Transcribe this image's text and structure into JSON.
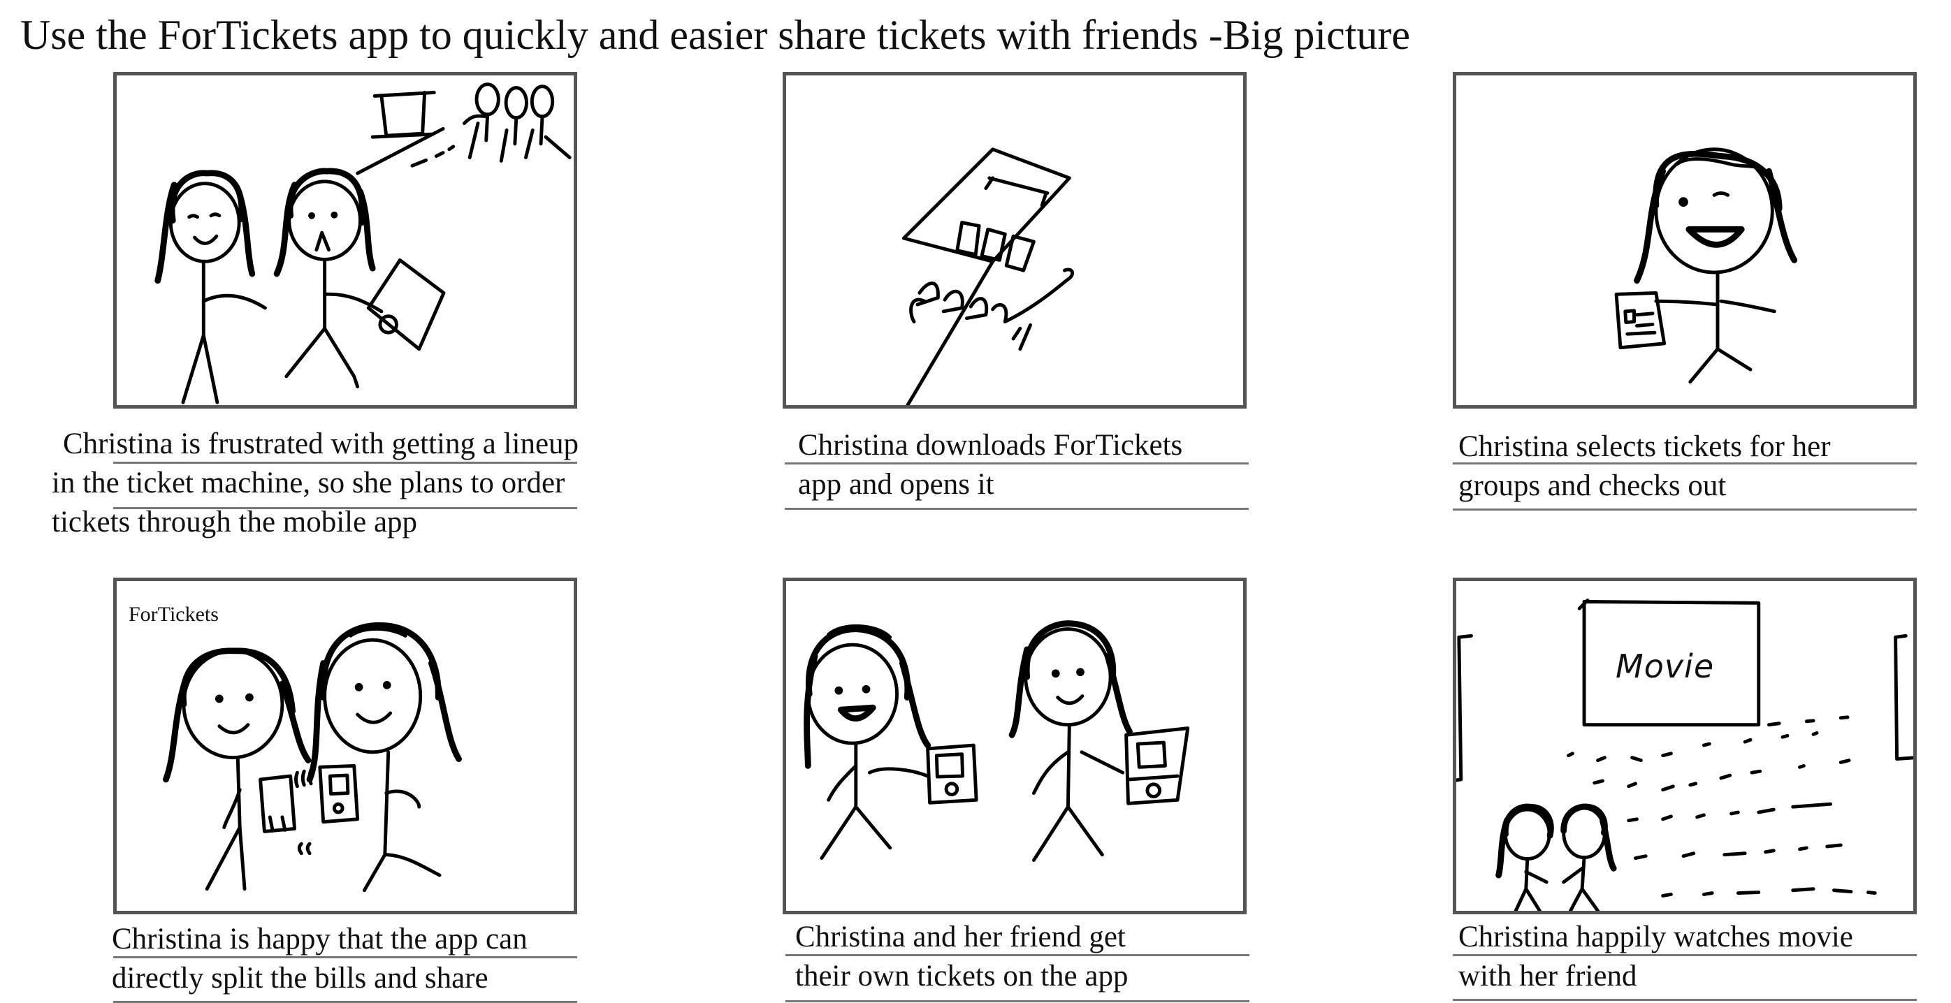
{
  "title": "Use the ForTickets app to quickly and easier share tickets with friends -Big picture",
  "panels": [
    {
      "caption_lines": [
        "Christina is frustrated with getting a lineup",
        "in the ticket machine, so she plans to order",
        "tickets through the mobile app"
      ]
    },
    {
      "caption_lines": [
        "Christina downloads ForTickets",
        "app and opens it"
      ]
    },
    {
      "caption_lines": [
        "Christina selects tickets for her",
        "groups and checks out"
      ]
    },
    {
      "caption_lines": [
        "Christina is happy that the app can",
        "directly split the bills and share"
      ],
      "sketch_text": "ForTickets"
    },
    {
      "caption_lines": [
        "Christina and her friend get",
        "their own tickets on the app"
      ]
    },
    {
      "caption_lines": [
        "Christina happily watches movie",
        "with her friend"
      ],
      "sketch_text": "Movie"
    }
  ]
}
